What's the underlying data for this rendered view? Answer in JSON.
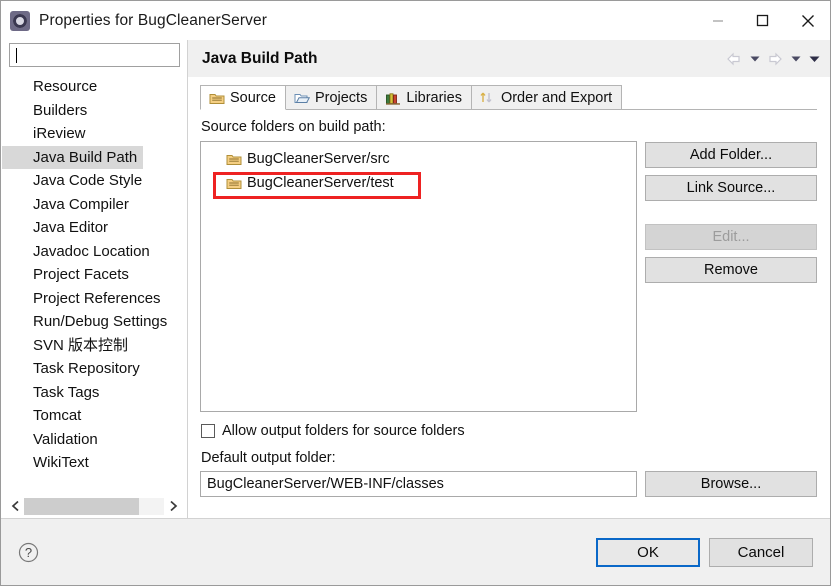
{
  "window": {
    "title": "Properties for BugCleanerServer",
    "app_icon": "gear-icon",
    "minimize_label": "Minimize",
    "maximize_label": "Maximize",
    "close_label": "Close"
  },
  "sidebar": {
    "filter_value": "",
    "filter_placeholder": "",
    "items": [
      {
        "label": "Resource",
        "selected": false
      },
      {
        "label": "Builders",
        "selected": false
      },
      {
        "label": "iReview",
        "selected": false
      },
      {
        "label": "Java Build Path",
        "selected": true
      },
      {
        "label": "Java Code Style",
        "selected": false
      },
      {
        "label": "Java Compiler",
        "selected": false
      },
      {
        "label": "Java Editor",
        "selected": false
      },
      {
        "label": "Javadoc Location",
        "selected": false
      },
      {
        "label": "Project Facets",
        "selected": false
      },
      {
        "label": "Project References",
        "selected": false
      },
      {
        "label": "Run/Debug Settings",
        "selected": false
      },
      {
        "label": "SVN 版本控制",
        "selected": false
      },
      {
        "label": "Task Repository",
        "selected": false
      },
      {
        "label": "Task Tags",
        "selected": false
      },
      {
        "label": "Tomcat",
        "selected": false
      },
      {
        "label": "Validation",
        "selected": false
      },
      {
        "label": "WikiText",
        "selected": false
      }
    ],
    "scroll_left_icon": "chevron-left-icon",
    "scroll_right_icon": "chevron-right-icon"
  },
  "page": {
    "title": "Java Build Path",
    "nav": {
      "back_icon": "arrow-left-icon",
      "back_caret_icon": "chevron-down-icon",
      "forward_icon": "arrow-right-icon",
      "forward_caret_icon": "chevron-down-icon",
      "menu_caret_icon": "chevron-down-icon"
    }
  },
  "tabs": [
    {
      "label": "Source",
      "icon": "package-folder-icon",
      "active": true
    },
    {
      "label": "Projects",
      "icon": "open-folder-icon",
      "active": false
    },
    {
      "label": "Libraries",
      "icon": "books-icon",
      "active": false
    },
    {
      "label": "Order and Export",
      "icon": "order-arrows-icon",
      "active": false
    }
  ],
  "source_tab": {
    "list_label": "Source folders on build path:",
    "entries": [
      {
        "label": "BugCleanerServer/src",
        "icon": "package-folder-icon",
        "highlighted": false
      },
      {
        "label": "BugCleanerServer/test",
        "icon": "package-folder-icon",
        "highlighted": true
      }
    ],
    "buttons": [
      {
        "label": "Add Folder...",
        "enabled": true
      },
      {
        "label": "Link Source...",
        "enabled": true
      },
      {
        "label": "Edit...",
        "enabled": false
      },
      {
        "label": "Remove",
        "enabled": true
      }
    ],
    "allow_output_folders": {
      "label": "Allow output folders for source folders",
      "checked": false
    },
    "default_output_folder": {
      "label": "Default output folder:",
      "value": "BugCleanerServer/WEB-INF/classes",
      "placeholder": "",
      "browse_label": "Browse..."
    },
    "annotation_color": "#ee2222"
  },
  "footer": {
    "help_icon": "question-mark-icon",
    "ok_label": "OK",
    "cancel_label": "Cancel"
  }
}
